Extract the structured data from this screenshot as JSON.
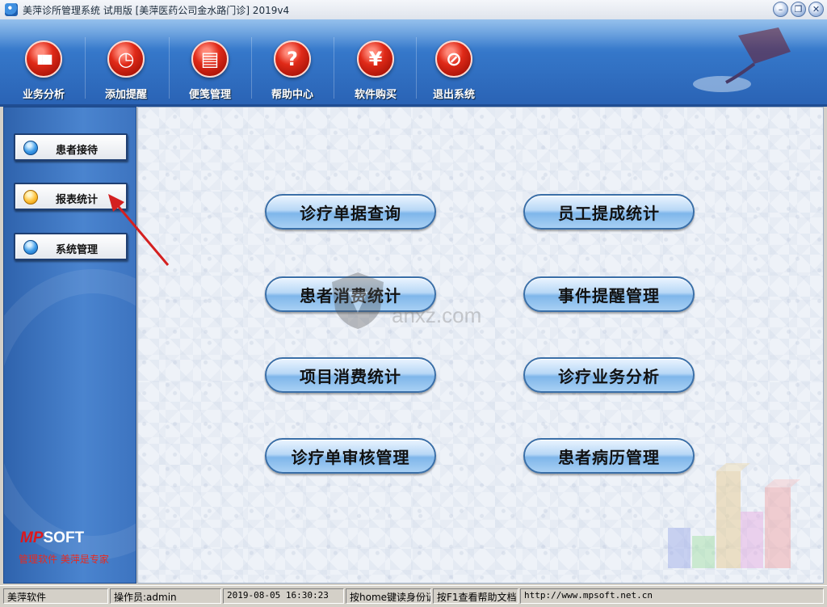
{
  "window": {
    "title": "美萍诊所管理系统 试用版 [美萍医药公司金水路门诊] 2019v4"
  },
  "toolbar": {
    "items": [
      {
        "label": "业务分析",
        "icon": "bar-chart-icon",
        "glyph": "▮▮▮"
      },
      {
        "label": "添加提醒",
        "icon": "clock-icon",
        "glyph": "◷"
      },
      {
        "label": "便笺管理",
        "icon": "notepad-icon",
        "glyph": "▤"
      },
      {
        "label": "帮助中心",
        "icon": "help-icon",
        "glyph": "?"
      },
      {
        "label": "软件购买",
        "icon": "yen-icon",
        "glyph": "¥"
      },
      {
        "label": "退出系统",
        "icon": "exit-icon",
        "glyph": "⊘"
      }
    ]
  },
  "sidebar": {
    "items": [
      {
        "label": "患者接待",
        "active": false
      },
      {
        "label": "报表统计",
        "active": true
      },
      {
        "label": "系统管理",
        "active": false
      }
    ],
    "brand": "MPSOFT",
    "slogan": "管理软件 美萍是专家"
  },
  "main": {
    "buttons": [
      "诊疗单据查询",
      "员工提成统计",
      "患者消费统计",
      "事件提醒管理",
      "项目消费统计",
      "诊疗业务分析",
      "诊疗单审核管理",
      "患者病历管理"
    ],
    "watermark": "anxz.com"
  },
  "statusbar": {
    "app": "美萍软件",
    "operator": "操作员:admin",
    "datetime": "2019-08-05 16:30:23",
    "hint_home": "按home键读身份证",
    "hint_f1": "按F1查看帮助文档",
    "url": "http://www.mpsoft.net.cn"
  },
  "colors": {
    "accent": "#3577c9",
    "toolbar_icon": "#e02a18",
    "arrow": "#d42020"
  }
}
